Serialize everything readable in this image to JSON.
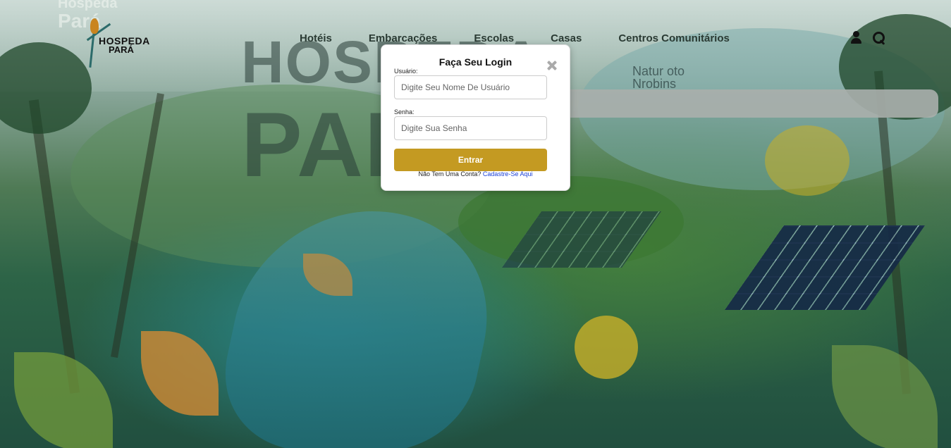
{
  "background_text": {
    "big_logo_top": "HOSPEDA",
    "big_logo_bottom": "PARA",
    "caption_line1": "Natur oto",
    "caption_line2": "Nrobins"
  },
  "header": {
    "ghost_logo_line1": "Hospeda",
    "ghost_logo_line2": "Pará",
    "brand_line1": "HOSPEDA",
    "brand_line2": "PARÁ",
    "nav": [
      {
        "label": "Hotéis"
      },
      {
        "label": "Embarcações"
      },
      {
        "label": "Escolas"
      },
      {
        "label": "Casas"
      },
      {
        "label": "Centros Comunitários"
      }
    ],
    "icons": {
      "user": "user-icon",
      "search": "search-icon"
    }
  },
  "login_modal": {
    "title": "Faça Seu Login",
    "close_icon": "close-icon",
    "username_label": "Usuário:",
    "username_placeholder": "Digite Seu Nome De Usuário",
    "password_label": "Senha:",
    "password_placeholder": "Digite Sua Senha",
    "submit_label": "Entrar",
    "signup_prompt": "Não Tem Uma Conta?",
    "signup_link": "Cadastre-Se Aqui"
  },
  "colors": {
    "accent_button": "#c49a22",
    "link": "#1a3fd6",
    "modal_bg": "#ffffff"
  }
}
